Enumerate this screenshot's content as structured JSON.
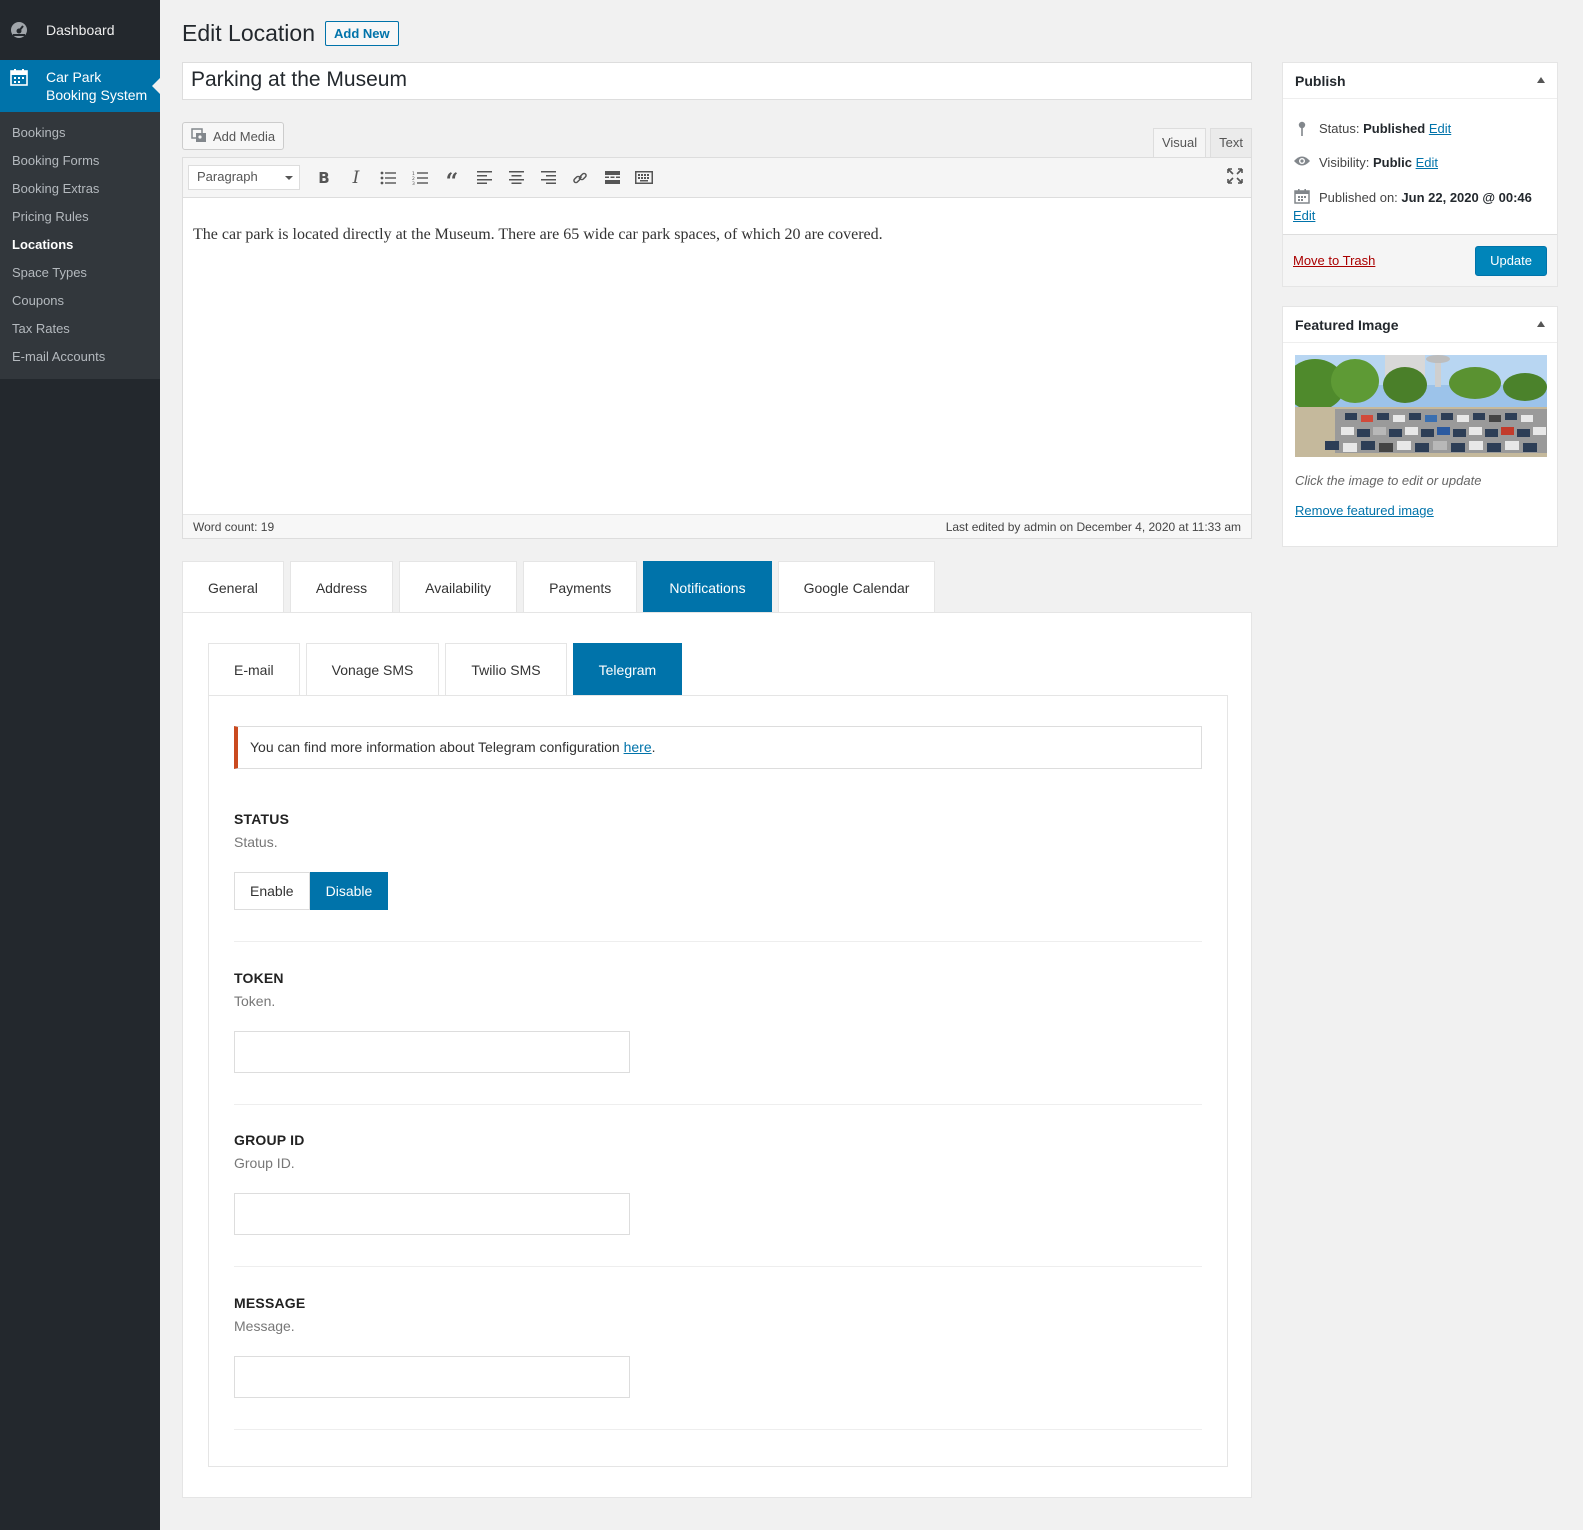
{
  "sidebar": {
    "dashboard": "Dashboard",
    "plugin": "Car Park Booking System",
    "plugin_line1": "Car Park",
    "plugin_line2": "Booking System",
    "items": [
      {
        "label": "Bookings",
        "current": false
      },
      {
        "label": "Booking Forms",
        "current": false
      },
      {
        "label": "Booking Extras",
        "current": false
      },
      {
        "label": "Pricing Rules",
        "current": false
      },
      {
        "label": "Locations",
        "current": true
      },
      {
        "label": "Space Types",
        "current": false
      },
      {
        "label": "Coupons",
        "current": false
      },
      {
        "label": "Tax Rates",
        "current": false
      },
      {
        "label": "E-mail Accounts",
        "current": false
      }
    ]
  },
  "header": {
    "title": "Edit Location",
    "add_new": "Add New"
  },
  "post": {
    "title": "Parking at the Museum"
  },
  "editor": {
    "add_media": "Add Media",
    "tab_visual": "Visual",
    "tab_text": "Text",
    "format": "Paragraph",
    "content": "The car park is located directly at the Museum. There are 65 wide car park spaces, of which 20 are covered.",
    "word_count": "Word count: 19",
    "last_edited": "Last edited by admin on December 4, 2020 at 11:33 am"
  },
  "tabs": [
    "General",
    "Address",
    "Availability",
    "Payments",
    "Notifications",
    "Google Calendar"
  ],
  "active_tab": "Notifications",
  "sub_tabs": [
    "E-mail",
    "Vonage SMS",
    "Twilio SMS",
    "Telegram"
  ],
  "active_sub_tab": "Telegram",
  "notice": {
    "text": "You can find more information about Telegram configuration ",
    "link": "here",
    "after": "."
  },
  "fields": {
    "status": {
      "label": "STATUS",
      "desc": "Status.",
      "options": [
        "Enable",
        "Disable"
      ],
      "selected": "Disable"
    },
    "token": {
      "label": "TOKEN",
      "desc": "Token.",
      "value": ""
    },
    "group_id": {
      "label": "GROUP ID",
      "desc": "Group ID.",
      "value": ""
    },
    "message": {
      "label": "MESSAGE",
      "desc": "Message.",
      "value": ""
    }
  },
  "publish": {
    "title": "Publish",
    "status_label": "Status:",
    "status_value": "Published",
    "visibility_label": "Visibility:",
    "visibility_value": "Public",
    "published_label": "Published on:",
    "published_value": "Jun 22, 2020 @ 00:46",
    "edit": "Edit",
    "trash": "Move to Trash",
    "update": "Update"
  },
  "featured": {
    "title": "Featured Image",
    "hint": "Click the image to edit or update",
    "remove": "Remove featured image"
  },
  "colors": {
    "accent": "#0073aa",
    "sidebar": "#23282d",
    "notice_border": "#ca4a1f"
  }
}
